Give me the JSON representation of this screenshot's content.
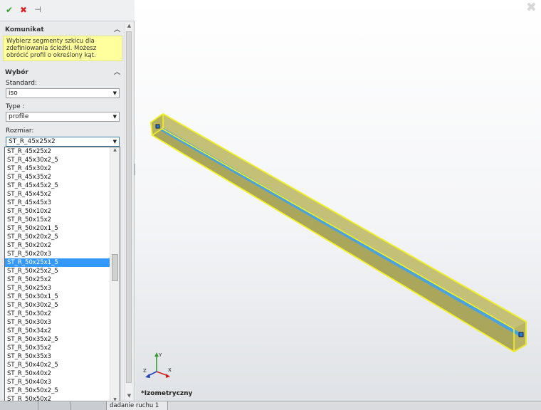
{
  "toolbar": {
    "ok_icon": "check-icon",
    "cancel_icon": "close-icon",
    "pin_icon": "pushpin-icon"
  },
  "message_section": {
    "title": "Komunikat",
    "text": "Wybierz segmenty szkicu dla zdefiniowania ścieżki. Możesz obrócić profil o określony kąt."
  },
  "selection_section": {
    "title": "Wybór",
    "standard": {
      "label": "Standard:",
      "value": "iso"
    },
    "type": {
      "label": "Type :",
      "value": "profile"
    },
    "size": {
      "label": "Rozmiar:",
      "value": "ST_R_45x25x2"
    }
  },
  "size_options": [
    "ST_R_45x25x2",
    "ST_R_45x30x2_5",
    "ST_R_45x30x2",
    "ST_R_45x35x2",
    "ST_R_45x45x2_5",
    "ST_R_45x45x2",
    "ST_R_45x45x3",
    "ST_R_50x10x2",
    "ST_R_50x15x2",
    "ST_R_50x20x1_5",
    "ST_R_50x20x2_5",
    "ST_R_50x20x2",
    "ST_R_50x20x3",
    "ST_R_50x25x1_5",
    "ST_R_50x25x2_5",
    "ST_R_50x25x2",
    "ST_R_50x25x3",
    "ST_R_50x30x1_5",
    "ST_R_50x30x2_5",
    "ST_R_50x30x2",
    "ST_R_50x30x3",
    "ST_R_50x34x2",
    "ST_R_50x35x2_5",
    "ST_R_50x35x2",
    "ST_R_50x35x3",
    "ST_R_50x40x2_5",
    "ST_R_50x40x2",
    "ST_R_50x40x3",
    "ST_R_50x50x2_5",
    "ST_R_50x50x2"
  ],
  "selected_option": "ST_R_50x25x1_5",
  "viewport": {
    "view_name": "*Izometryczny"
  },
  "bottom_tabs": [
    "",
    "",
    "",
    "dadanie ruchu 1"
  ],
  "triad": {
    "x": "X",
    "y": "Y",
    "z": "Z"
  },
  "colors": {
    "highlight": "#3399ff",
    "message_bg": "#ffff9e",
    "beam_edge": "#ffff00",
    "beam_core": "#4aa3e0"
  }
}
